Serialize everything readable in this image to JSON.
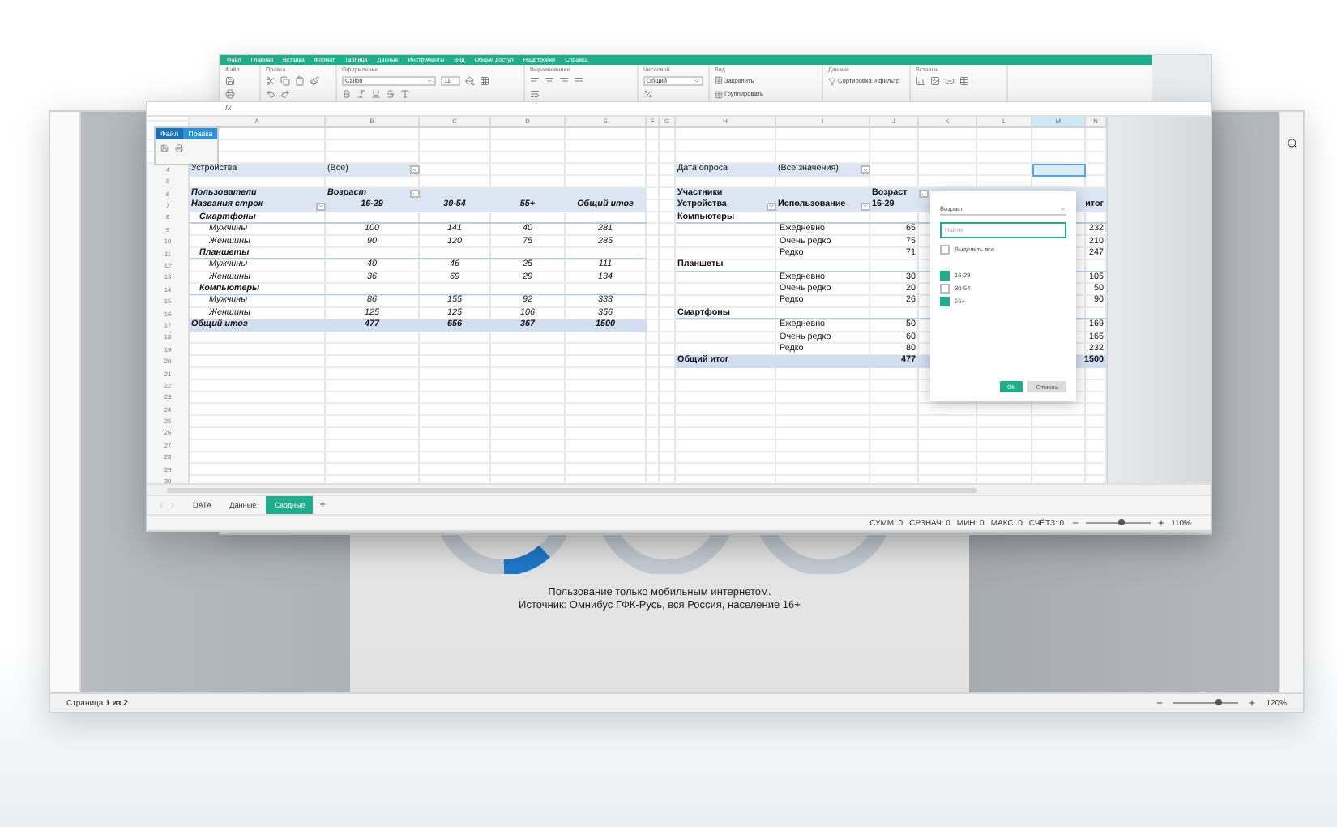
{
  "document_window": {
    "caption": [
      "Пользование только мобильным интернетом.",
      "Источник: Омнибус ГФК-Русь, вся Россия, население 16+"
    ],
    "page_status": "Страница **1 из 2**",
    "zoom": "120%",
    "zoom_slider": {
      "level": 0.7
    }
  },
  "small_window": {
    "tabs": [
      {
        "label": "Файл",
        "selected": true
      },
      {
        "label": "Правка",
        "selected": false
      }
    ]
  },
  "ribbon": {
    "menu": [
      "Файл",
      "Главная",
      "Вставка",
      "Формат",
      "Таблица",
      "Данные",
      "Инструменты",
      "Вид",
      "Общий доступ",
      "Надстройки",
      "Справка"
    ],
    "groups": [
      {
        "label": "Файл",
        "kind": "file"
      },
      {
        "label": "Правка",
        "kind": "edit"
      },
      {
        "label": "Оформление",
        "kind": "format",
        "font": "Calibri",
        "size": "11"
      },
      {
        "label": "Выравнивание",
        "kind": "align"
      },
      {
        "label": "Числовой",
        "kind": "number",
        "format": "Общий"
      },
      {
        "label": "Вид",
        "kind": "view",
        "buttons": [
          "Закрепить",
          "Группировать"
        ]
      },
      {
        "label": "Данные",
        "kind": "data",
        "filter": "Сортировка и фильтр"
      },
      {
        "label": "Вставка",
        "kind": "insert"
      }
    ]
  },
  "sheet": {
    "formula_label": "fx",
    "columns": [
      {
        "label": "A",
        "selected": false
      },
      {
        "label": "B",
        "selected": false
      },
      {
        "label": "C",
        "selected": false
      },
      {
        "label": "D",
        "selected": false
      },
      {
        "label": "E",
        "selected": false
      },
      {
        "label": "F",
        "selected": false
      },
      {
        "label": "G",
        "selected": false
      },
      {
        "label": "H",
        "selected": false
      },
      {
        "label": "I",
        "selected": false
      },
      {
        "label": "J",
        "selected": false
      },
      {
        "label": "K",
        "selected": false
      },
      {
        "label": "L",
        "selected": false
      },
      {
        "label": "M",
        "selected": true
      },
      {
        "label": "N",
        "selected": false
      }
    ],
    "row_numbers": [
      "4",
      "5",
      "6",
      "7",
      "8",
      "9",
      "10",
      "11",
      "12",
      "13",
      "14",
      "15",
      "16",
      "17",
      "18",
      "19",
      "20",
      "21",
      "22",
      "23",
      "24",
      "25",
      "26",
      "27",
      "28",
      "29",
      "30"
    ]
  },
  "pivot_left": {
    "filter": {
      "label": "Устройства",
      "value": "(Все)"
    },
    "corner": "Пользователи",
    "column_field": "Возраст",
    "row_label": "Названия строк",
    "columns": [
      "16-29",
      "30-54",
      "55+",
      "Общий итог"
    ],
    "rows": [
      {
        "kind": "group",
        "label": "Смартфоны"
      },
      {
        "kind": "item",
        "label": "Мужчины",
        "values": [
          "100",
          "141",
          "40",
          "281"
        ]
      },
      {
        "kind": "item",
        "label": "Женщины",
        "values": [
          "90",
          "120",
          "75",
          "285"
        ]
      },
      {
        "kind": "group",
        "label": "Планшеты"
      },
      {
        "kind": "item",
        "label": "Мужчины",
        "values": [
          "40",
          "46",
          "25",
          "111"
        ]
      },
      {
        "kind": "item",
        "label": "Женщины",
        "values": [
          "36",
          "69",
          "29",
          "134"
        ]
      },
      {
        "kind": "group",
        "label": "Компьютеры"
      },
      {
        "kind": "item",
        "label": "Мужчины",
        "values": [
          "86",
          "155",
          "92",
          "333"
        ]
      },
      {
        "kind": "item",
        "label": "Женщины",
        "values": [
          "125",
          "125",
          "106",
          "356"
        ]
      },
      {
        "kind": "total",
        "label": "Общий итог",
        "values": [
          "477",
          "656",
          "367",
          "1500"
        ]
      }
    ]
  },
  "pivot_right": {
    "filter": {
      "label": "Дата опроса",
      "value": "(Все значения)"
    },
    "corner": "Участники",
    "column_field": "Возраст",
    "row_fields": [
      "Устройства",
      "Использование"
    ],
    "columns": [
      "16-29",
      "итог"
    ],
    "rows": [
      {
        "kind": "group",
        "label": "Компьютеры"
      },
      {
        "kind": "item",
        "label": "Ежедневно",
        "values": [
          "65",
          "232"
        ]
      },
      {
        "kind": "item",
        "label": "Очень редко",
        "values": [
          "75",
          "210"
        ]
      },
      {
        "kind": "item",
        "label": "Редко",
        "values": [
          "71",
          "247"
        ]
      },
      {
        "kind": "group",
        "label": "Планшеты"
      },
      {
        "kind": "item",
        "label": "Ежедневно",
        "values": [
          "30",
          "105"
        ]
      },
      {
        "kind": "item",
        "label": "Очень редко",
        "values": [
          "20",
          "50"
        ]
      },
      {
        "kind": "item",
        "label": "Редко",
        "values": [
          "26",
          "90"
        ]
      },
      {
        "kind": "group",
        "label": "Смартфоны"
      },
      {
        "kind": "item",
        "label": "Ежедневно",
        "values": [
          "50",
          "169"
        ]
      },
      {
        "kind": "item",
        "label": "Очень редко",
        "values": [
          "60",
          "165"
        ]
      },
      {
        "kind": "item",
        "label": "Редко",
        "values": [
          "80",
          "232"
        ]
      },
      {
        "kind": "total",
        "label": "Общий итог",
        "values": [
          "477",
          "1500"
        ]
      }
    ]
  },
  "filter_popup": {
    "field": "Возраст",
    "search_placeholder": "Найти",
    "select_all": {
      "label": "Выделить все",
      "checked": false
    },
    "items": [
      {
        "label": "16-29",
        "checked": true
      },
      {
        "label": "30-54",
        "checked": false
      },
      {
        "label": "55+",
        "checked": true
      }
    ],
    "buttons": [
      {
        "label": "Ok",
        "kind": "primary"
      },
      {
        "label": "Отмена",
        "kind": "secondary"
      }
    ]
  },
  "sheet_tabs": [
    {
      "label": "DATA",
      "selected": false
    },
    {
      "label": "Данные",
      "selected": false
    },
    {
      "label": "Сводные",
      "selected": true
    }
  ],
  "add_sheet": "+",
  "status_bar": {
    "stats": [
      "СУММ: 0",
      "СРЗНАЧ: 0",
      "МИН: 0",
      "МАКС: 0",
      "СЧЁТЗ: 0"
    ],
    "zoom": "110%",
    "zoom_slider": {
      "level": 0.55
    }
  }
}
